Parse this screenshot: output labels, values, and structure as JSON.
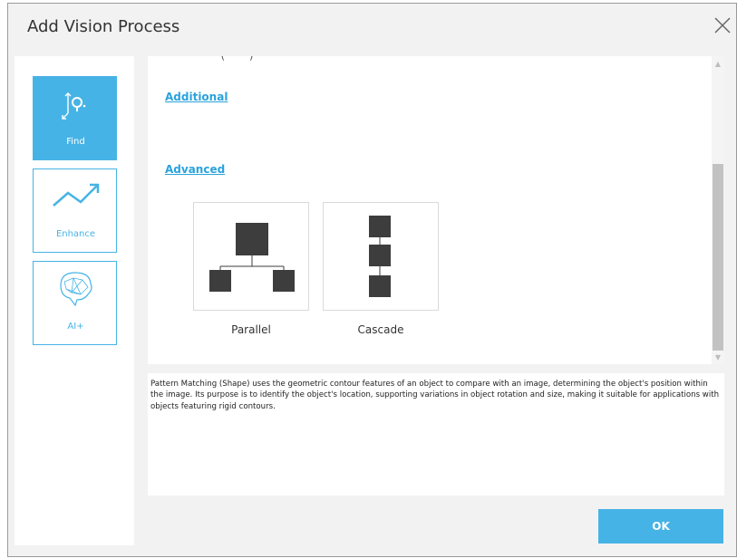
{
  "dialog": {
    "title": "Add Vision Process",
    "close_icon": "close-icon",
    "ok_label": "OK"
  },
  "sidebar": {
    "items": [
      {
        "label": "Find",
        "icon": "find-point-icon",
        "active": true
      },
      {
        "label": "Enhance",
        "icon": "trend-up-icon",
        "active": false
      },
      {
        "label": "AI+",
        "icon": "ai-brain-icon",
        "active": false
      }
    ]
  },
  "content": {
    "sections": {
      "additional": "Additional",
      "advanced": "Advanced"
    },
    "options": [
      {
        "label": "Parallel",
        "icon": "parallel-diagram-icon"
      },
      {
        "label": "Cascade",
        "icon": "cascade-diagram-icon"
      }
    ]
  },
  "description": "Pattern Matching (Shape) uses the geometric contour features of an object to compare with an image, determining the object's position within the image. Its purpose is to identify the object's location, supporting variations in object rotation and size, making it suitable for applications with objects featuring rigid contours.",
  "colors": {
    "accent": "#46b3e6",
    "link": "#2aa2dc",
    "diagram": "#3d3d3d"
  }
}
